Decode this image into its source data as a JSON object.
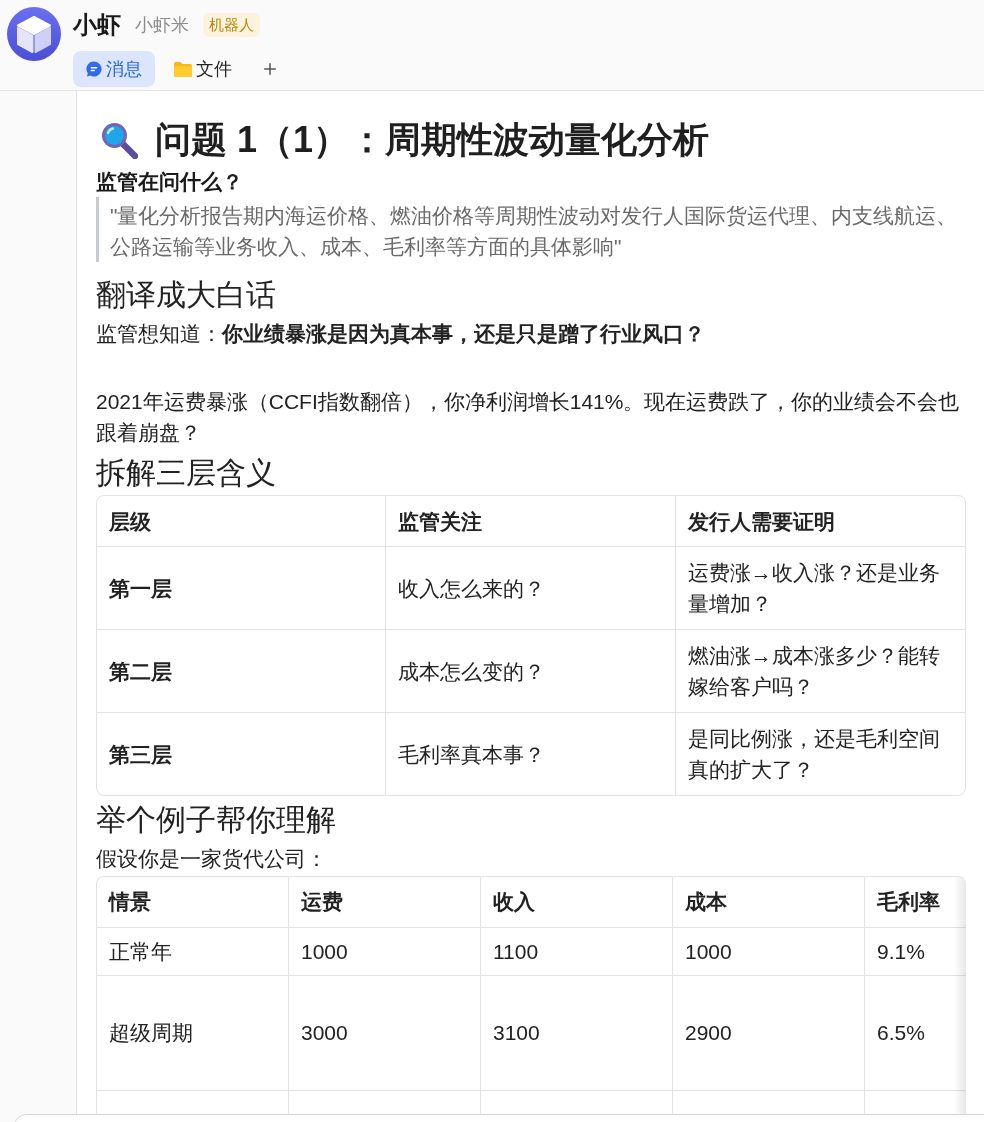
{
  "header": {
    "name": "小虾",
    "handle": "小虾米",
    "badge": "机器人",
    "tabs": [
      {
        "label": "消息",
        "kind": "chat",
        "selected": true
      },
      {
        "label": "文件",
        "kind": "folder",
        "selected": false
      }
    ]
  },
  "article": {
    "title": "问题 1（1）：周期性波动量化分析",
    "blocks": [
      {
        "kind": "label",
        "text": "监管在问什么？"
      },
      {
        "kind": "quote",
        "text": "\"量化分析报告期内海运价格、燃油价格等周期性波动对发行人国际货运代理、内支线航运、公路运输等业务收入、成本、毛利率等方面的具体影响\""
      },
      {
        "kind": "heading",
        "text": "翻译成大白话"
      },
      {
        "kind": "paragraph",
        "text": "监管想知道：**你业绩暴涨是因为真本事，还是只是蹭了行业风口？**"
      },
      {
        "kind": "paragraph",
        "text": "2021年运费暴涨（CCFI指数翻倍），你净利润增长141%。现在运费跌了，你的业绩会不会也跟着崩盘？"
      },
      {
        "kind": "heading",
        "text": "拆解三层含义"
      },
      {
        "kind": "table",
        "columns": [
          "层级",
          "监管关注",
          "发行人需要证明"
        ],
        "rows": [
          [
            "第一层",
            "收入怎么来的？",
            "运费涨→收入涨？还是业务量增加？"
          ],
          [
            "第二层",
            "成本怎么变的？",
            "燃油涨→成本涨多少？能转嫁给客户吗？"
          ],
          [
            "第三层",
            "毛利率真本事？",
            "是同比例涨，还是毛利空间真的扩大了？"
          ]
        ]
      },
      {
        "kind": "heading",
        "text": "举个例子帮你理解"
      },
      {
        "kind": "paragraph",
        "text": "假设你是一家货代公司："
      },
      {
        "kind": "scroll_table",
        "columns": [
          "情景",
          "运费",
          "收入",
          "成本",
          "毛利率"
        ],
        "rows": [
          [
            "正常年",
            "1000",
            "1100",
            "1000",
            "9.1%"
          ],
          [
            "超级周期",
            "3000",
            "3100",
            "2900",
            "6.5%"
          ]
        ]
      }
    ]
  }
}
